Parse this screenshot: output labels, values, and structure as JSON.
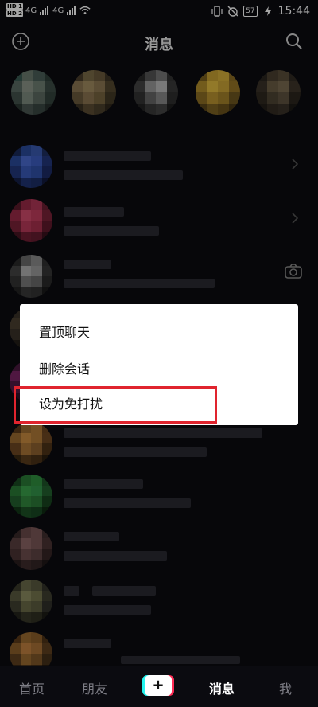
{
  "status_bar": {
    "network_labels": [
      "HD 1",
      "HD 2"
    ],
    "signal_1": "4G",
    "signal_2": "4G",
    "battery": "57",
    "time": "15:44"
  },
  "header": {
    "title": "消息"
  },
  "menu": {
    "items": [
      "置顶聊天",
      "删除会话",
      "设为免打扰"
    ]
  },
  "nav": {
    "tabs": [
      "首页",
      "朋友",
      "消息",
      "我"
    ],
    "active": "消息",
    "plus_label": "+"
  }
}
